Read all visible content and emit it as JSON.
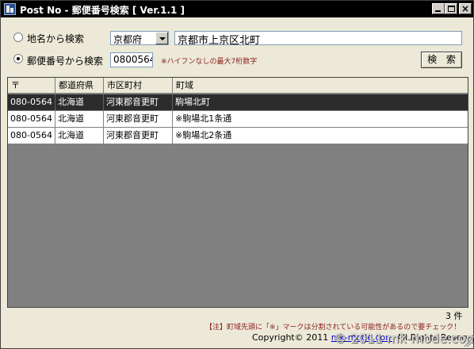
{
  "window": {
    "title": "Post No - 郵便番号検索 [ Ver.1.1 ]",
    "close_glyph": "×"
  },
  "search": {
    "mode_place_label": "地名から検索",
    "mode_zip_label": "郵便番号から検索",
    "selected_mode": "zip",
    "prefecture": "京都府",
    "address_value": "京都市上京区北町",
    "zip_value": "0800564",
    "zip_hint": "※ハイフンなしの最大7桁数字",
    "search_button": "検 索"
  },
  "results": {
    "columns": [
      "〒",
      "都道府県",
      "市区町村",
      "町域"
    ],
    "rows": [
      {
        "zip": "080-0564",
        "prefecture": "北海道",
        "city": "河東郡音更町",
        "town": "駒場北町",
        "selected": true
      },
      {
        "zip": "080-0564",
        "prefecture": "北海道",
        "city": "河東郡音更町",
        "town": "※駒場北1条通",
        "selected": false
      },
      {
        "zip": "080-0564",
        "prefecture": "北海道",
        "city": "河東郡音更町",
        "town": "※駒場北2条通",
        "selected": false
      }
    ],
    "count_text": "3 件"
  },
  "footer": {
    "note": "【注】町域先頭に「※」マークは分割されている可能性があるので要チェック！",
    "copyright_prefix": "Copyright© 2011 ",
    "copyright_link": "mk-mode.com",
    "copyright_suffix": " All Rights Reserved.",
    "watermark": "© 2011 mk-mode.com"
  },
  "colors": {
    "title_bar": "#000000",
    "window_bg": "#ece9d8",
    "grid_bg": "#808080",
    "selected_row": "#2c2c2c",
    "hint_text": "#8b1a1a"
  }
}
